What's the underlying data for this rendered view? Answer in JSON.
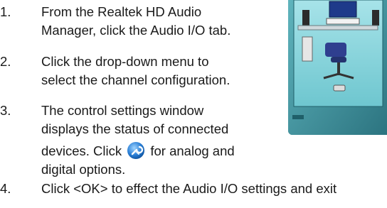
{
  "steps": [
    {
      "num": "1.",
      "line1": "From the Realtek HD Audio",
      "line2": "Manager, click the Audio I/O tab."
    },
    {
      "num": "2.",
      "line1": "Click the drop-down menu to",
      "line2": "select the channel configuration."
    },
    {
      "num": "3.",
      "line1": "The control settings window",
      "line2": "displays the status of connected",
      "line3a": "devices. Click",
      "line3b": "for analog and",
      "line4": "digital options."
    },
    {
      "num": "4.",
      "line1": "Click <OK> to effect the Audio I/O settings and exit"
    }
  ],
  "icons": {
    "inline_icon": "wrench-gear-icon"
  },
  "colors": {
    "text": "#1a1a1a",
    "thumb_frame": "#3a8f9a",
    "thumb_panel": "#7fd0d8",
    "icon_blue": "#2a7fd6"
  }
}
